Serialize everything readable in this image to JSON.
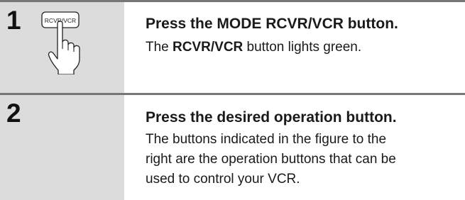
{
  "steps": [
    {
      "number": "1",
      "button_label": "RCVR/VCR",
      "heading": "Press the MODE RCVR/VCR button.",
      "body_pre": "The ",
      "body_bold": "RCVR/VCR",
      "body_post": " button lights green."
    },
    {
      "number": "2",
      "heading": "Press the desired operation button.",
      "body_lines": [
        "The buttons indicated in the figure to the",
        "right are the operation buttons that can be",
        "used to control your VCR."
      ]
    }
  ],
  "colors": {
    "panel": "#dcdcdc",
    "rule": "#777777"
  }
}
